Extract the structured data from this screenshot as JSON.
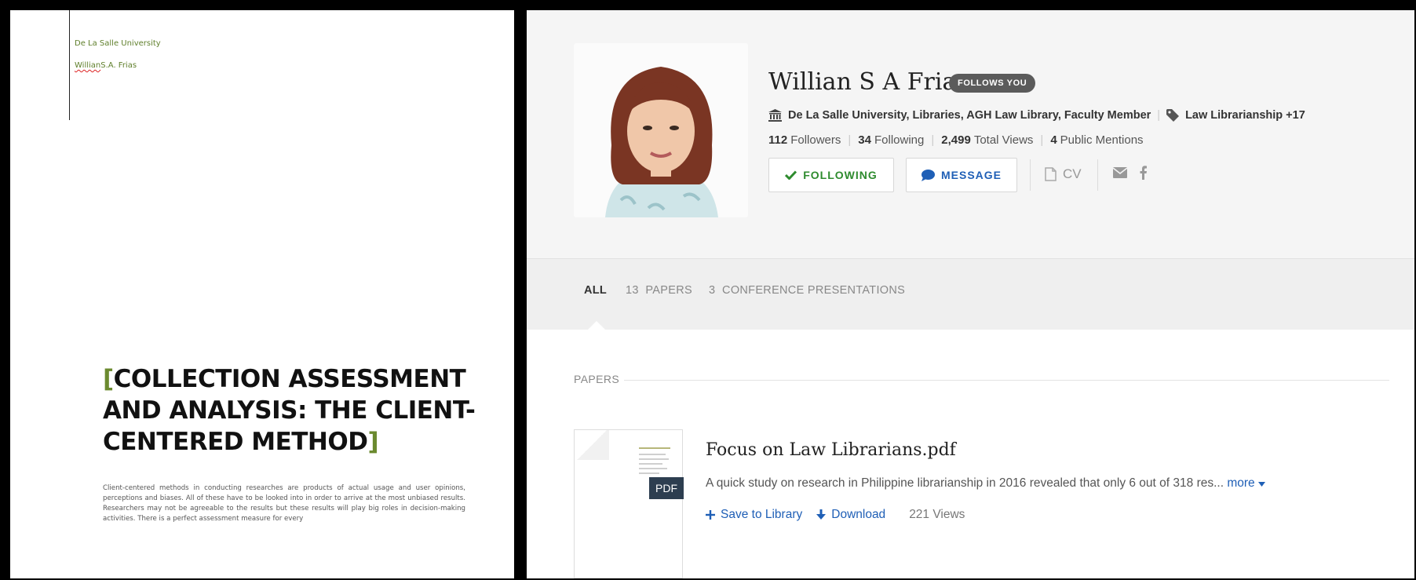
{
  "document": {
    "institution": "De La Salle University",
    "author_first": "Willian",
    "author_rest": "S.A. Frias",
    "title_open_bracket": "[",
    "title_text": "COLLECTION ASSESSMENT AND ANALYSIS: THE CLIENT-CENTERED METHOD",
    "title_close_bracket": "]",
    "body": "Client-centered methods in conducting researches are products of actual usage and user opinions, perceptions and biases. All of these have to be looked into in order to arrive at the most unbiased results.  Researchers may not be agreeable to the results but these results will play big roles in decision-making activities.  There is a perfect assessment measure for every"
  },
  "profile": {
    "name": "Willian S A Frias",
    "follows_badge": "FOLLOWS YOU",
    "affiliation": "De La Salle University, Libraries, AGH Law Library, Faculty Member",
    "research_tag": "Law Librarianship +17",
    "stats": {
      "followers_count": "112",
      "followers_label": "Followers",
      "following_count": "34",
      "following_label": "Following",
      "views_count": "2,499",
      "views_label": "Total Views",
      "mentions_count": "4",
      "mentions_label": "Public Mentions"
    },
    "buttons": {
      "following": "FOLLOWING",
      "message": "MESSAGE",
      "cv": "CV"
    },
    "icons": [
      "institution-icon",
      "tag-icon",
      "check-icon",
      "chat-bubble-icon",
      "document-icon",
      "envelope-icon",
      "facebook-icon"
    ]
  },
  "tabs": {
    "all": "ALL",
    "papers_count": "13",
    "papers_label": "PAPERS",
    "conf_count": "3",
    "conf_label": "CONFERENCE PRESENTATIONS"
  },
  "papers_section": {
    "label": "PAPERS",
    "items": [
      {
        "thumb_tag": "PDF",
        "title": "Focus on Law Librarians.pdf",
        "abstract": "A quick study on research in Philippine librarianship in 2016 revealed that only 6 out of 318 res...",
        "more_label": "more",
        "save_label": "Save to Library",
        "download_label": "Download",
        "views": "221 Views"
      }
    ]
  },
  "colors": {
    "accent_blue": "#1f5fb6",
    "following_green": "#2e8b2e",
    "doc_green": "#5f7f2b",
    "badge_gray": "#5b5b5b"
  }
}
